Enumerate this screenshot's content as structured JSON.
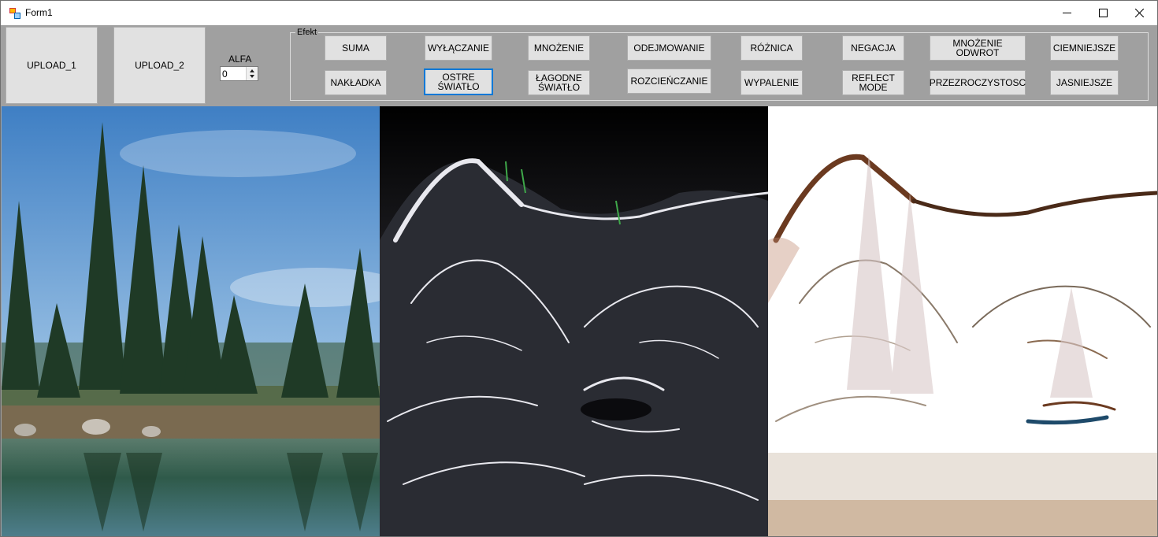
{
  "window": {
    "title": "Form1"
  },
  "controls": {
    "upload1": "UPLOAD_1",
    "upload2": "UPLOAD_2",
    "alfa_label": "ALFA",
    "alfa_value": "0"
  },
  "effects": {
    "legend": "Efekt",
    "row1": [
      "SUMA",
      "WYŁĄCZANIE",
      "MNOŻENIE",
      "ODEJMOWANIE",
      "RÓŻNICA",
      "NEGACJA",
      "MNOŻENIE ODWROT",
      "CIEMNIEJSZE"
    ],
    "row2": [
      "NAKŁADKA",
      "OSTRE\nŚWIATŁO",
      "ŁAGODNE\nŚWIATŁO",
      "ROZCIEŃCZANIE",
      "WYPALENIE",
      "REFLECT\nMODE",
      "PRZEZROCZYSTOSC",
      "JASNIEJSZE"
    ]
  },
  "images": {
    "image1": "forest-lake-photo",
    "image2": "fractal-cat-photo",
    "image3": "blended-result-photo"
  },
  "colors": {
    "toolbar": "#a0a0a0",
    "button": "#e1e1e1",
    "focus": "#0078d7"
  }
}
